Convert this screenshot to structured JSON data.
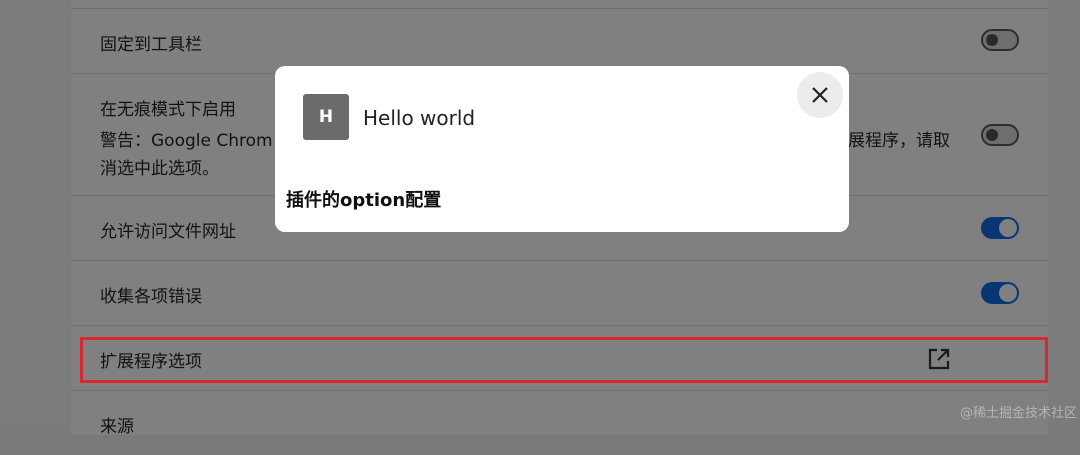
{
  "settings": {
    "rows": [
      {
        "label": "固定到工具栏",
        "toggle": "off"
      },
      {
        "label": "在无痕模式下启用",
        "warning_left": "警告：Google Chrom",
        "warning_right": "展程序，请取",
        "warning_line2": "消选中此选项。",
        "toggle": "off"
      },
      {
        "label": "允许访问文件网址",
        "toggle": "on"
      },
      {
        "label": "收集各项错误",
        "toggle": "on"
      },
      {
        "label": "扩展程序选项",
        "icon": "open-in-new-icon"
      },
      {
        "label": "来源"
      }
    ]
  },
  "modal": {
    "avatar_letter": "H",
    "title": "Hello world",
    "body": "插件的option配置",
    "close_icon": "close-icon"
  },
  "watermark": "@稀土掘金技术社区",
  "colors": {
    "highlight": "#d9262d",
    "toggle_on": "#0a3574"
  }
}
